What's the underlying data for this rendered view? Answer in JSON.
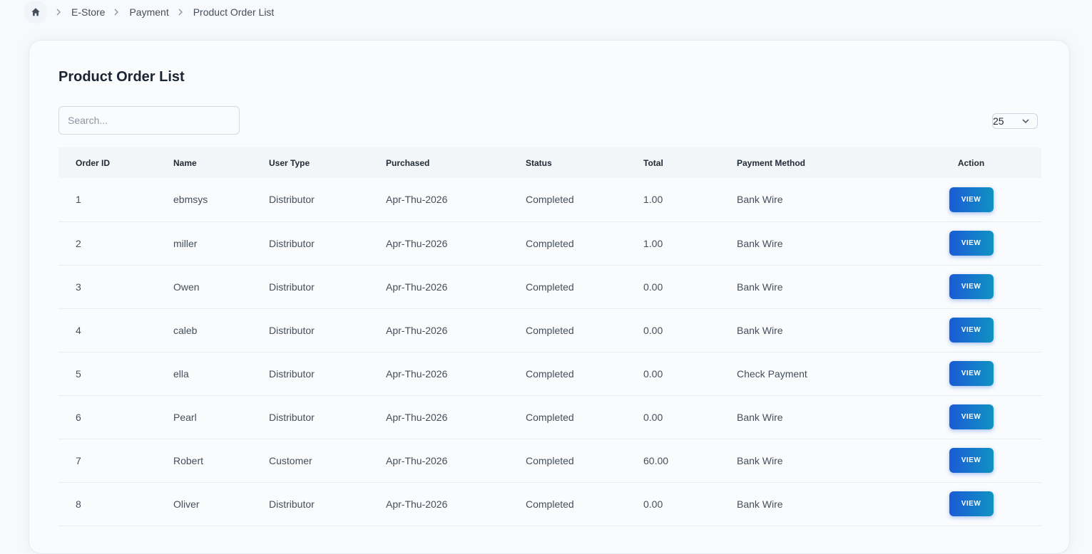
{
  "breadcrumb": {
    "items": [
      "E-Store",
      "Payment"
    ],
    "current": "Product Order List"
  },
  "page": {
    "title": "Product Order List"
  },
  "search": {
    "placeholder": "Search...",
    "value": ""
  },
  "page_size": {
    "value": "25"
  },
  "table": {
    "columns": [
      "Order ID",
      "Name",
      "User Type",
      "Purchased",
      "Status",
      "Total",
      "Payment Method",
      "Action"
    ],
    "action_label": "VIEW",
    "rows": [
      {
        "id": "1",
        "name": "ebmsys",
        "user_type": "Distributor",
        "purchased": "Apr-Thu-2026",
        "status": "Completed",
        "total": "1.00",
        "payment": "Bank Wire"
      },
      {
        "id": "2",
        "name": "miller",
        "user_type": "Distributor",
        "purchased": "Apr-Thu-2026",
        "status": "Completed",
        "total": "1.00",
        "payment": "Bank Wire"
      },
      {
        "id": "3",
        "name": "Owen",
        "user_type": "Distributor",
        "purchased": "Apr-Thu-2026",
        "status": "Completed",
        "total": "0.00",
        "payment": "Bank Wire"
      },
      {
        "id": "4",
        "name": "caleb",
        "user_type": "Distributor",
        "purchased": "Apr-Thu-2026",
        "status": "Completed",
        "total": "0.00",
        "payment": "Bank Wire"
      },
      {
        "id": "5",
        "name": "ella",
        "user_type": "Distributor",
        "purchased": "Apr-Thu-2026",
        "status": "Completed",
        "total": "0.00",
        "payment": "Check Payment"
      },
      {
        "id": "6",
        "name": "Pearl",
        "user_type": "Distributor",
        "purchased": "Apr-Thu-2026",
        "status": "Completed",
        "total": "0.00",
        "payment": "Bank Wire"
      },
      {
        "id": "7",
        "name": "Robert",
        "user_type": "Customer",
        "purchased": "Apr-Thu-2026",
        "status": "Completed",
        "total": "60.00",
        "payment": "Bank Wire"
      },
      {
        "id": "8",
        "name": "Oliver",
        "user_type": "Distributor",
        "purchased": "Apr-Thu-2026",
        "status": "Completed",
        "total": "0.00",
        "payment": "Bank Wire"
      }
    ]
  },
  "colors": {
    "accent_start": "#1a5bd6",
    "accent_end": "#1193c2"
  },
  "icons": {
    "home": "home-icon",
    "separator": "chevron-right-icon",
    "dropdown": "chevron-down-icon"
  }
}
